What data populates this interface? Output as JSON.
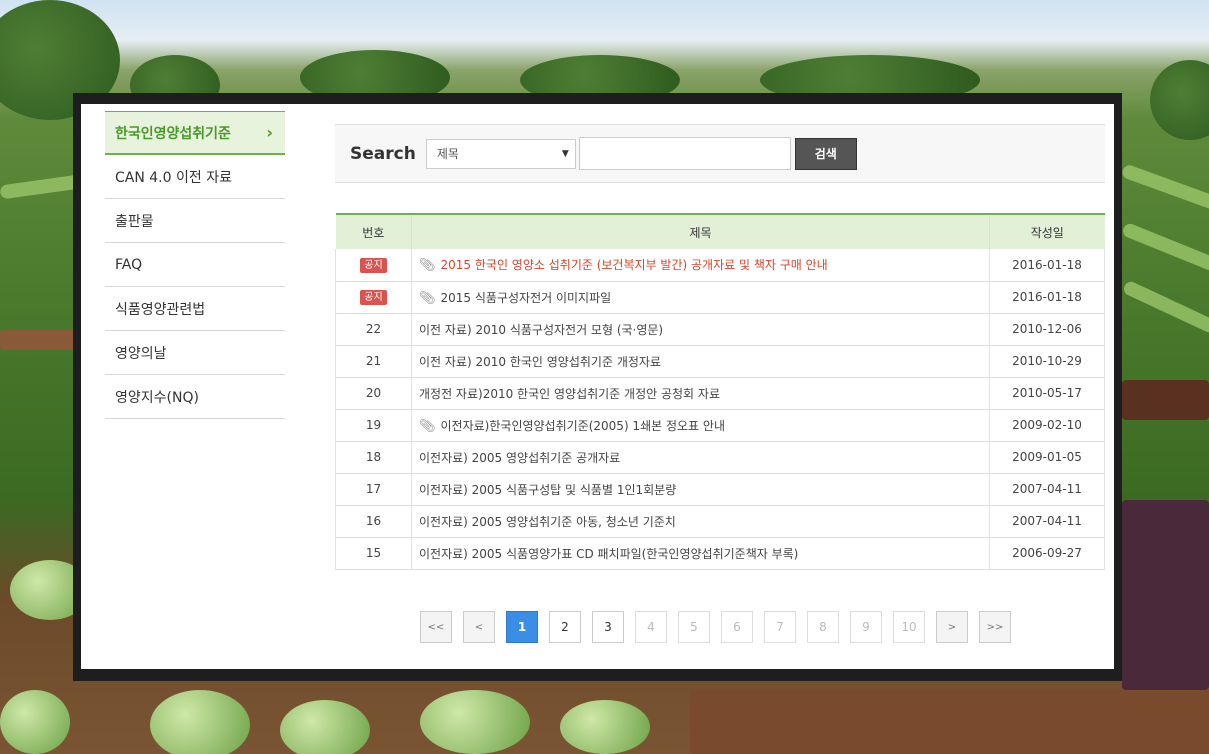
{
  "sidebar": {
    "items": [
      {
        "label": "한국인영양섭취기준",
        "active": true
      },
      {
        "label": "CAN 4.0 이전 자료"
      },
      {
        "label": "출판물"
      },
      {
        "label": "FAQ"
      },
      {
        "label": "식품영양관련법"
      },
      {
        "label": "영양의날"
      },
      {
        "label": "영양지수(NQ)"
      }
    ]
  },
  "search": {
    "label": "Search",
    "select_value": "제목",
    "button_label": "검색",
    "input_value": ""
  },
  "board": {
    "headers": {
      "num": "번호",
      "title": "제목",
      "date": "작성일"
    },
    "notice_badge": "공지",
    "rows": [
      {
        "num": "공지",
        "title": "2015 한국인 영양소 섭취기준 (보건복지부 발간) 공개자료 및 책자 구매 안내",
        "date": "2016-01-18"
      },
      {
        "num": "공지",
        "title": "2015 식품구성자전거 이미지파일",
        "date": "2016-01-18"
      },
      {
        "num": "22",
        "title": "이전 자료) 2010 식품구성자전거 모형 (국·영문)",
        "date": "2010-12-06"
      },
      {
        "num": "21",
        "title": "이전 자료) 2010 한국인 영양섭취기준 개정자료",
        "date": "2010-10-29"
      },
      {
        "num": "20",
        "title": "개정전 자료)2010 한국인 영양섭취기준 개정안 공청회 자료",
        "date": "2010-05-17"
      },
      {
        "num": "19",
        "title": "이전자료)한국인영양섭취기준(2005) 1쇄본 정오표 안내",
        "date": "2009-02-10"
      },
      {
        "num": "18",
        "title": "이전자료) 2005 영양섭취기준 공개자료",
        "date": "2009-01-05"
      },
      {
        "num": "17",
        "title": "이전자료) 2005 식품구성탑 및 식품별 1인1회분량",
        "date": "2007-04-11"
      },
      {
        "num": "16",
        "title": "이전자료) 2005 영양섭취기준 아동, 청소년 기준치",
        "date": "2007-04-11"
      },
      {
        "num": "15",
        "title": "이전자료) 2005 식품영양가표 CD 패치파일(한국인영양섭취기준책자 부록)",
        "date": "2006-09-27"
      }
    ]
  },
  "pager": {
    "first": "<<",
    "prev": "<",
    "pages": [
      "1",
      "2",
      "3",
      "4",
      "5",
      "6",
      "7",
      "8",
      "9",
      "10"
    ],
    "current": "1",
    "next": ">",
    "last": ">>"
  },
  "colors": {
    "accent_green": "#6fb04a",
    "notice_red": "#d9534f",
    "pager_active": "#3a8ee6"
  },
  "icons": {
    "attachment": "paperclip-icon",
    "sidebar_chevron": "chevron-right-icon",
    "select_arrow": "caret-down-icon"
  }
}
